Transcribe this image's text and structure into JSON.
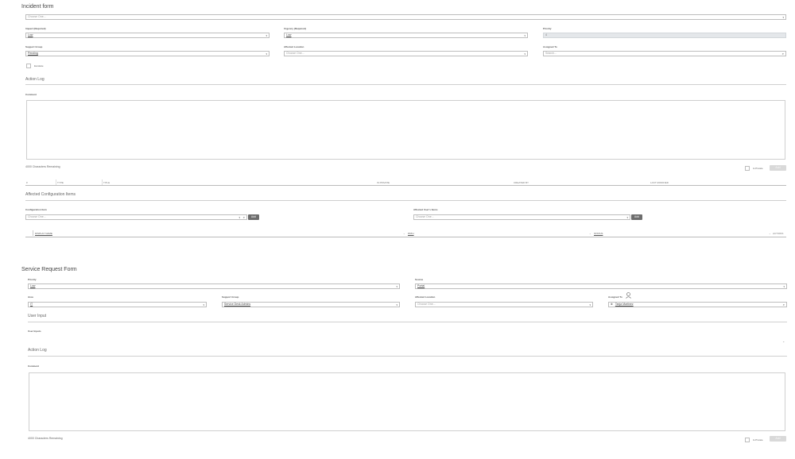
{
  "incident": {
    "title": "Incident form",
    "top_select_placeholder": "Choose One...",
    "impact": {
      "label": "Impact (Required)",
      "value": "Low"
    },
    "urgency": {
      "label": "Urgency (Required)",
      "value": "Low"
    },
    "priority": {
      "label": "Priority",
      "value": "4"
    },
    "support_group": {
      "label": "Support Group",
      "value": "Pending"
    },
    "affected_location": {
      "label": "Affected Location",
      "placeholder": "Choose One..."
    },
    "assigned_to": {
      "label": "Assigned To",
      "placeholder": "Search..."
    },
    "escalate_label": "Escalate",
    "action_log_title": "Action Log",
    "comment_label": "Comment",
    "chars_remaining": "4000 Characters Remaining",
    "is_private_label": "Is Private",
    "add_label": "Add",
    "log_columns": [
      "#",
      "TYPE",
      "TITLE",
      "IS PRIVATE",
      "CREATED BY",
      "LAST MODIFIED"
    ],
    "affected_ci_title": "Affected Configuration Items",
    "config_item": {
      "label": "Configuration Item",
      "placeholder": "Choose One..."
    },
    "affected_users_items": {
      "label": "Affected User's Items",
      "placeholder": "Choose One..."
    },
    "ci_columns": [
      "DISPLAY NAME",
      "PATH",
      "STATUS",
      "ACTIONS"
    ]
  },
  "service_request": {
    "title": "Service Request Form",
    "priority": {
      "label": "Priority",
      "value": "Low"
    },
    "source": {
      "label": "Source",
      "value": "Portal"
    },
    "area": {
      "label": "Area",
      "value": "IT"
    },
    "support_group": {
      "label": "Support Group",
      "value": "Service Desk Admins"
    },
    "affected_location": {
      "label": "Affected Location",
      "placeholder": "Choose One..."
    },
    "assigned_to": {
      "label": "Assigned To",
      "value": "Tanja Martinez"
    },
    "user_input_title": "User Input",
    "user_inputs_label": "User Inputs",
    "action_log_title": "Action Log",
    "comment_label": "Comment",
    "chars_remaining": "4000 Characters Remaining",
    "is_private_label": "Is Private",
    "add_label": "Add"
  },
  "icons": {
    "caret": "▾",
    "search": "⌕",
    "user": "person-icon",
    "clear": "⊗"
  }
}
